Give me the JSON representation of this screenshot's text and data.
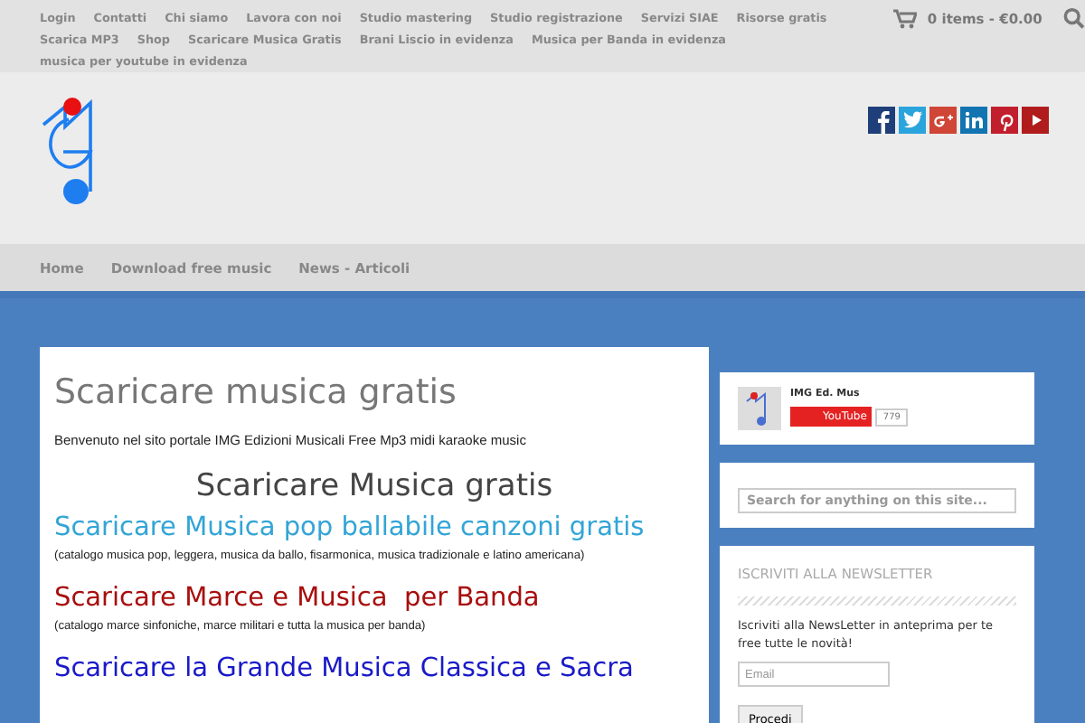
{
  "top_menu": [
    "Login",
    "Contatti",
    "Chi siamo",
    "Lavora con noi",
    "Studio mastering",
    "Studio registrazione",
    "Servizi SIAE",
    "Risorse gratis",
    "Scarica MP3",
    "Shop",
    "Scaricare Musica Gratis",
    "Brani Liscio in evidenza",
    "Musica per Banda in evidenza",
    "musica per youtube in evidenza"
  ],
  "cart": {
    "label": "0 items - €0.00"
  },
  "social": [
    {
      "kind": "facebook",
      "color": "#1e3f7a"
    },
    {
      "kind": "twitter",
      "color": "#2aa4dc"
    },
    {
      "kind": "googleplus",
      "color": "#cf4536"
    },
    {
      "kind": "linkedin",
      "color": "#1274b0"
    },
    {
      "kind": "pinterest",
      "color": "#c21f2e"
    },
    {
      "kind": "youtube",
      "color": "#b01c1c"
    }
  ],
  "main_nav": [
    "Home",
    "Download free music",
    "News - Articoli"
  ],
  "article": {
    "title": "Scaricare musica gratis",
    "intro": "Benvenuto nel sito portale IMG Edizioni Musicali Free Mp3 midi karaoke music",
    "heading": "Scaricare Musica gratis",
    "sections": [
      {
        "title": "Scaricare Musica pop ballabile canzoni gratis",
        "color": "#33a5d6",
        "note": "(catalogo musica pop, leggera, musica da ballo, fisarmonica, musica tradizionale e latino americana)"
      },
      {
        "title": "Scaricare Marce e Musica  per Banda",
        "color": "#a80e0e",
        "note": "(catalogo marce sinfoniche, marce militari e tutta la musica per banda)"
      },
      {
        "title": "Scaricare la Grande Musica Classica e Sacra",
        "color": "#1a1ac8"
      }
    ]
  },
  "sidebar": {
    "channel": {
      "name": "IMG Ed. Mus",
      "button": "YouTube",
      "count": "779"
    },
    "search": {
      "placeholder": "Search for anything on this site..."
    },
    "newsletter": {
      "title": "ISCRIVITI ALLA NEWSLETTER",
      "text": "Iscriviti alla NewsLetter in anteprima per te free tutte le novità!",
      "email": {
        "placeholder": "Email"
      },
      "button": "Procedi"
    }
  }
}
